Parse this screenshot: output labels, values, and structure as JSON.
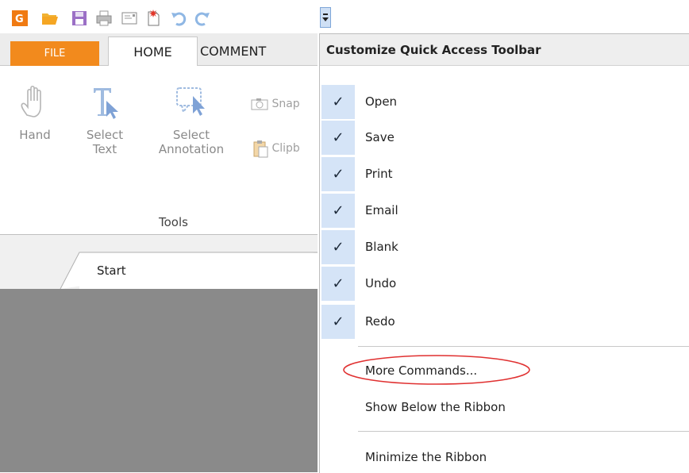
{
  "quick_access": {
    "icons": [
      "app-logo-icon",
      "open-folder-icon",
      "save-icon",
      "print-icon",
      "email-icon",
      "blank-page-icon",
      "undo-icon",
      "redo-icon",
      "customize-dropdown-icon"
    ]
  },
  "ribbon": {
    "tabs": {
      "file": "FILE",
      "home": "HOME",
      "comment": "COMMENT"
    },
    "tools": {
      "hand": "Hand",
      "select_text_line1": "Select",
      "select_text_line2": "Text",
      "select_annotation_line1": "Select",
      "select_annotation_line2": "Annotation",
      "snapshot": "Snap",
      "clipboard": "Clipb"
    },
    "group_label": "Tools"
  },
  "document_tabs": {
    "start": "Start"
  },
  "menu": {
    "title": "Customize Quick Access Toolbar",
    "checked_items": [
      "Open",
      "Save",
      "Print",
      "Email",
      "Blank",
      "Undo",
      "Redo"
    ],
    "more_commands": "More Commands...",
    "show_below": "Show Below the Ribbon",
    "minimize": "Minimize the Ribbon"
  },
  "colors": {
    "file_tab": "#f28a1d",
    "check_highlight": "#d5e4f7",
    "annotation_circle": "#e03030",
    "document_background": "#8a8a8a"
  }
}
